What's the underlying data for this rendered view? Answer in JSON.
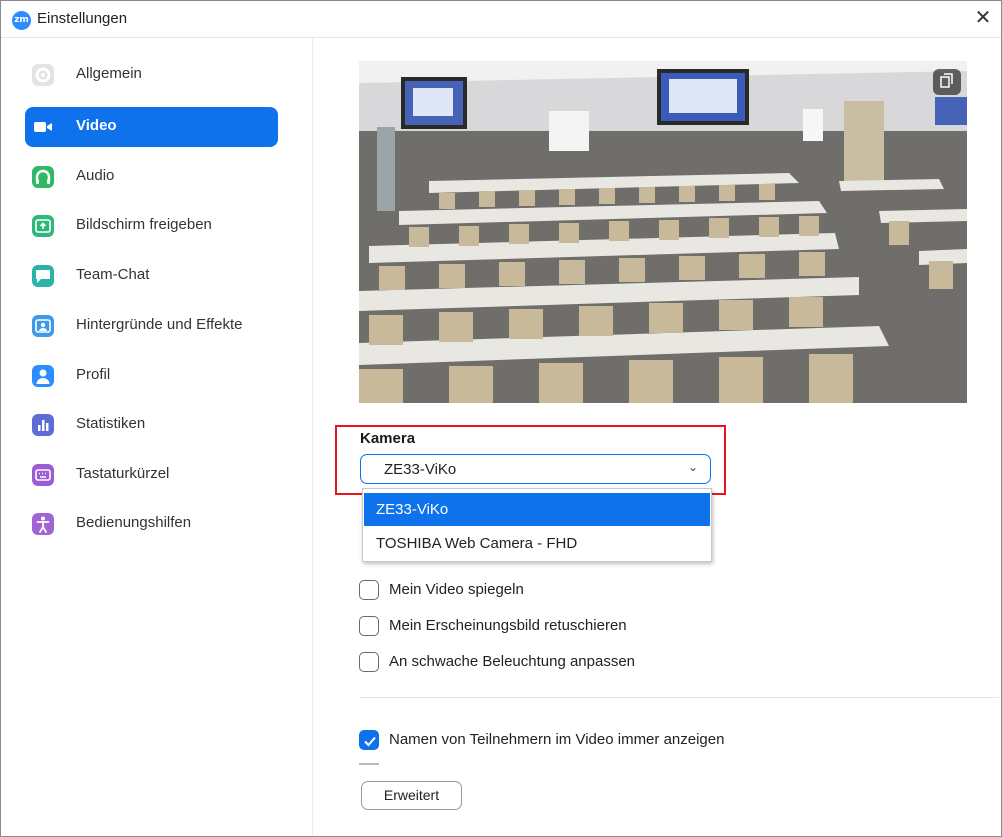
{
  "window": {
    "title": "Einstellungen",
    "logo_text": "zm",
    "close_glyph": "✕"
  },
  "sidebar": {
    "items": [
      {
        "label": "Allgemein",
        "icon": "gear-icon",
        "color": "#e3e3e3",
        "active": false
      },
      {
        "label": "Video",
        "icon": "video-camera-icon",
        "color": "#0e72ed",
        "active": true
      },
      {
        "label": "Audio",
        "icon": "headphones-icon",
        "color": "#2fb865",
        "active": false
      },
      {
        "label": "Bildschirm freigeben",
        "icon": "share-screen-icon",
        "color": "#2fb87b",
        "active": false
      },
      {
        "label": "Team-Chat",
        "icon": "chat-icon",
        "color": "#2ab3a7",
        "active": false
      },
      {
        "label": "Hintergründe und Effekte",
        "icon": "background-icon",
        "color": "#3d9be9",
        "active": false
      },
      {
        "label": "Profil",
        "icon": "profile-icon",
        "color": "#2d8cff",
        "active": false
      },
      {
        "label": "Statistiken",
        "icon": "statistics-icon",
        "color": "#5f6bd6",
        "active": false
      },
      {
        "label": "Tastaturkürzel",
        "icon": "keyboard-icon",
        "color": "#9b5cd6",
        "active": false
      },
      {
        "label": "Bedienungshilfen",
        "icon": "accessibility-icon",
        "color": "#a164d6",
        "active": false
      }
    ]
  },
  "camera": {
    "label": "Kamera",
    "selected": "ZE33-ViKo",
    "chevron": "⌄",
    "options": [
      "ZE33-ViKo",
      "TOSHIBA Web Camera - FHD"
    ]
  },
  "options": {
    "mirror": {
      "label": "Mein Video spiegeln",
      "checked": false
    },
    "touch_up": {
      "label": "Mein Erscheinungsbild retuschieren",
      "checked": false
    },
    "low_light": {
      "label": "An schwache Beleuchtung anpassen",
      "checked": false
    },
    "show_names": {
      "label": "Namen von Teilnehmern im Video immer anzeigen",
      "checked": true
    }
  },
  "advanced_button": "Erweitert",
  "colors": {
    "accent": "#0e72ed",
    "highlight": "#e8161c"
  }
}
